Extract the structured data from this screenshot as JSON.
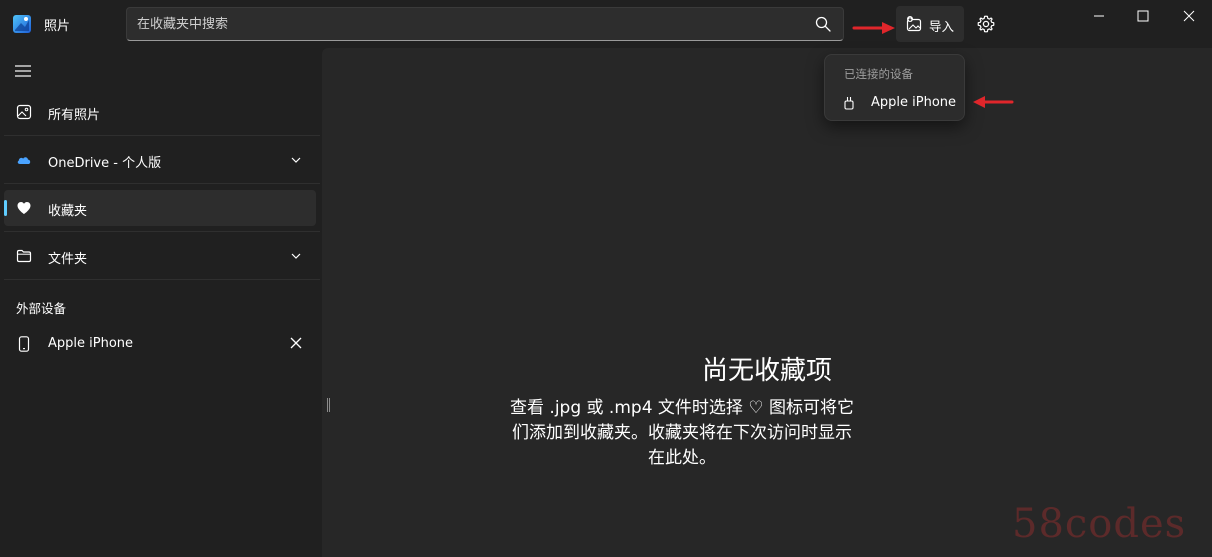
{
  "app": {
    "title": "照片"
  },
  "search": {
    "placeholder": "在收藏夹中搜索"
  },
  "toolbar": {
    "import_label": "导入"
  },
  "sidebar": {
    "items": [
      {
        "label": "所有照片"
      },
      {
        "label": "OneDrive - 个人版"
      },
      {
        "label": "收藏夹"
      },
      {
        "label": "文件夹"
      }
    ],
    "external_title": "外部设备",
    "external_devices": [
      {
        "label": "Apple iPhone"
      }
    ]
  },
  "dropdown": {
    "header": "已连接的设备",
    "items": [
      {
        "label": "Apple iPhone"
      }
    ]
  },
  "main": {
    "empty_title": "尚无收藏项",
    "empty_desc": "查看 .jpg 或 .mp4 文件时选择 ♡ 图标可将它们添加到收藏夹。收藏夹将在下次访问时显示在此处。"
  },
  "watermark": "58codes",
  "colors": {
    "accent": "#60cdff",
    "annotation_arrow": "#e0262b",
    "background": "#202020",
    "content": "#272727"
  }
}
